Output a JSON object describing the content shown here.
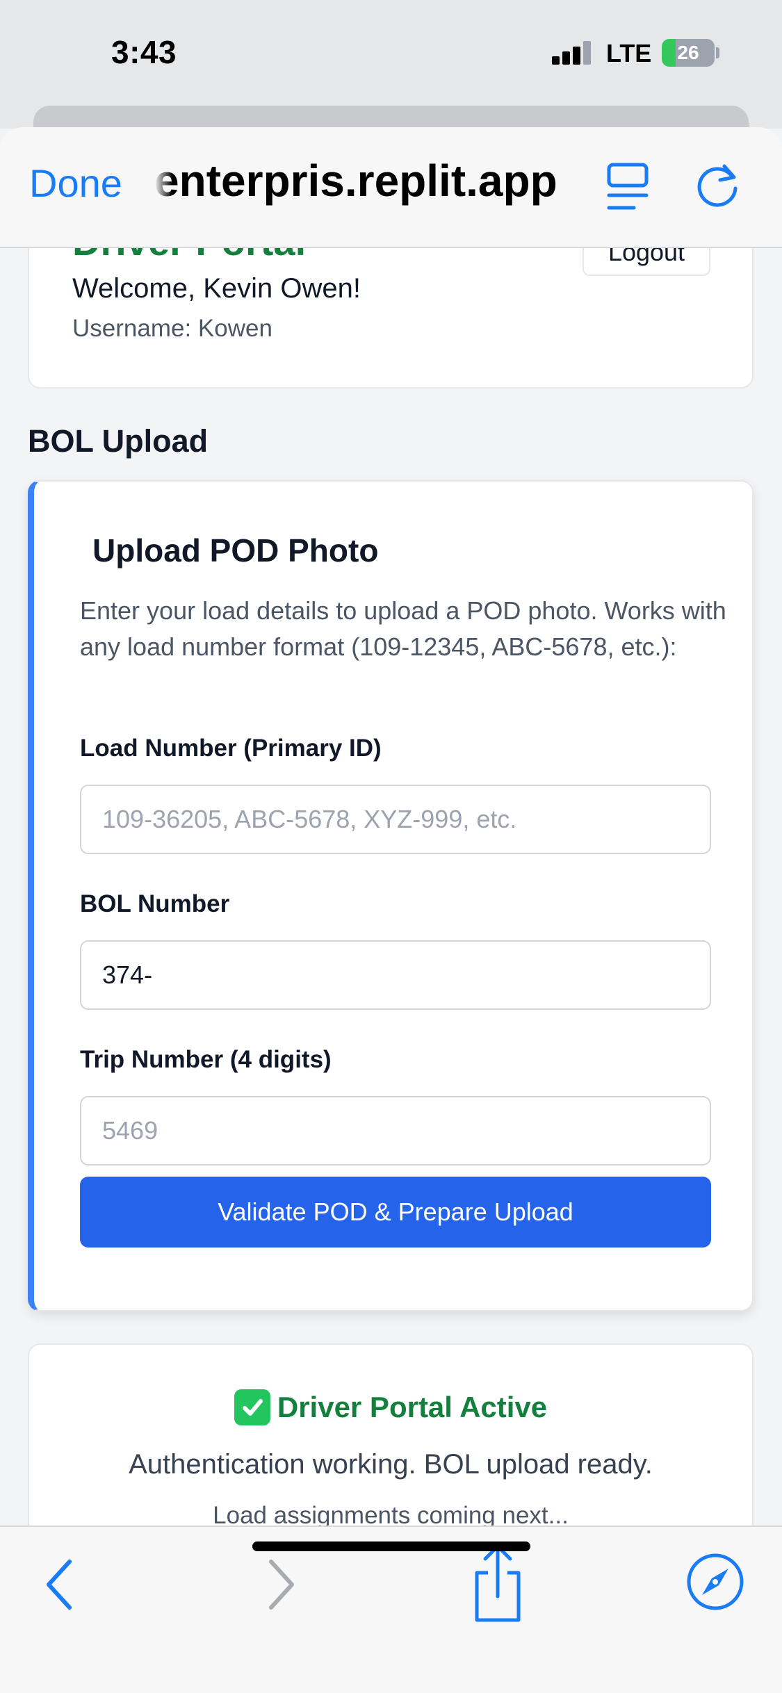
{
  "status_bar": {
    "time": "3:43",
    "network": "LTE",
    "battery": "26",
    "battery_level": 0.26
  },
  "browser": {
    "done_label": "Done",
    "url": "enterpris.replit.app"
  },
  "header_card": {
    "title": "Driver Portal",
    "logout_label": "Logout",
    "welcome": "Welcome, Kevin Owen!",
    "username": "Username: Kowen"
  },
  "section_title": "BOL Upload",
  "upload_card": {
    "title": "Upload POD Photo",
    "description": "Enter your load details to upload a POD photo. Works with any load number format (109-12345, ABC-5678, etc.):",
    "fields": [
      {
        "label": "Load Number (Primary ID)",
        "value": "",
        "placeholder": "109-36205, ABC-5678, XYZ-999, etc."
      },
      {
        "label": "BOL Number",
        "value": "374-",
        "placeholder": ""
      },
      {
        "label": "Trip Number (4 digits)",
        "value": "",
        "placeholder": "5469"
      }
    ],
    "submit_label": "Validate POD & Prepare Upload"
  },
  "status_card": {
    "title": "Driver Portal Active",
    "line1": "Authentication working. BOL upload ready.",
    "line2": "Load assignments coming next..."
  },
  "colors": {
    "accent": "#2563eb",
    "ios_blue": "#1a7cf5",
    "success_green": "#15803d"
  },
  "icons": [
    "reader-icon",
    "reload-icon",
    "back-icon",
    "forward-icon",
    "share-icon",
    "compass-icon",
    "checkmark-icon"
  ]
}
